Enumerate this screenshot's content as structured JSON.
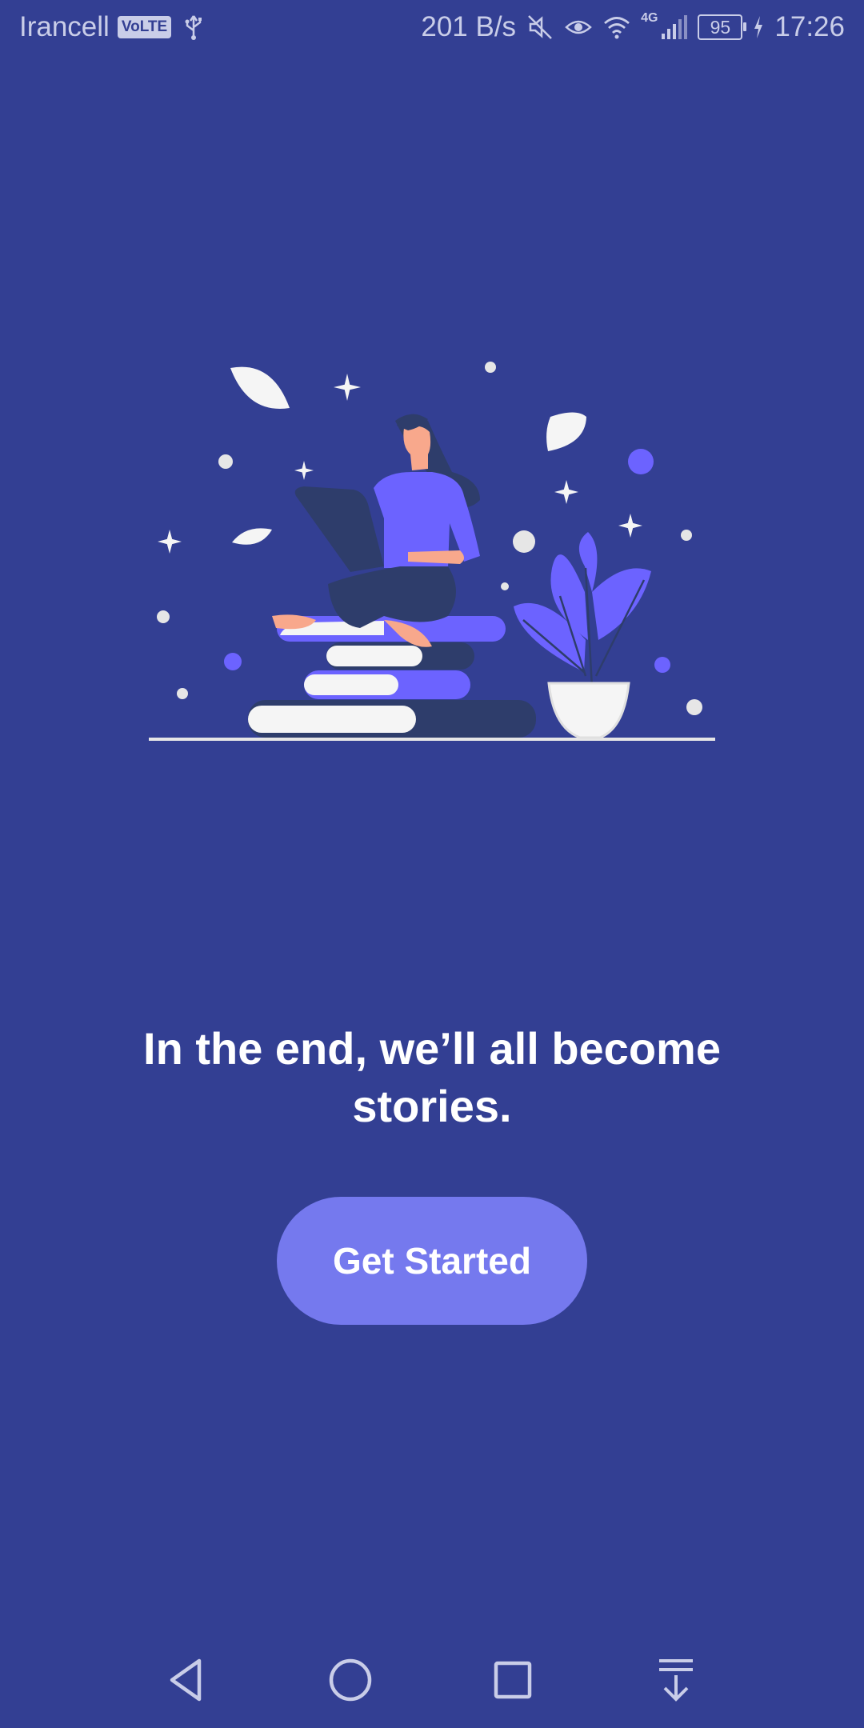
{
  "status_bar": {
    "carrier": "Irancell",
    "volte_label": "VoLTE",
    "net_speed": "201 B/s",
    "network_type": "4G",
    "battery_level": "95",
    "time": "17:26",
    "icons": [
      "usb-icon",
      "mute-icon",
      "eye-comfort-icon",
      "wifi-icon",
      "signal-icon",
      "battery-icon",
      "charging-icon"
    ]
  },
  "main": {
    "headline": "In the end, we’ll all become stories.",
    "cta_label": "Get Started"
  },
  "nav_bar": {
    "icons": [
      "back-icon",
      "home-icon",
      "recents-icon",
      "notification-pull-icon"
    ]
  },
  "colors": {
    "background": "#333f93",
    "accent": "#7579ee",
    "illustration_dark": "#2e3d6b",
    "illustration_purple": "#6c63ff"
  }
}
